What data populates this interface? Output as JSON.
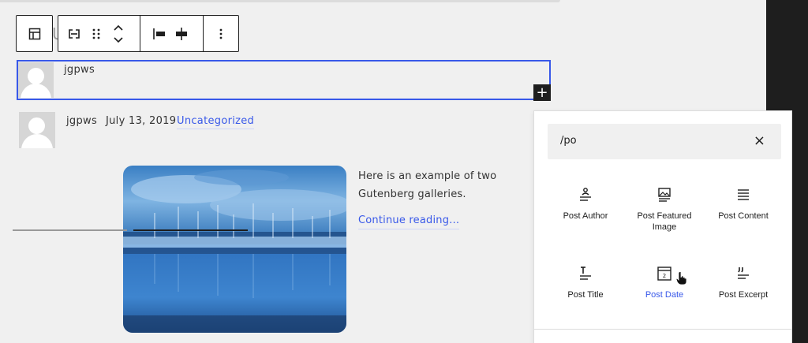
{
  "toolbar": {
    "parent_icon": "layout-icon",
    "items": [
      "transform-icon",
      "drag-handle-icon",
      "move-up-down-icon",
      "align-left-icon",
      "align-center-icon",
      "more-options-icon"
    ]
  },
  "selected_block": {
    "author_name": "jgpws",
    "inserter_label": "+"
  },
  "post_meta": {
    "author": "jgpws",
    "date": "July 13, 2019",
    "category": "Uncategorized"
  },
  "post": {
    "excerpt": "Here is an example of two Gutenberg galleries.",
    "read_more": "Continue reading…"
  },
  "inserter": {
    "search_value": "/po",
    "clear_label": "×",
    "blocks": [
      {
        "label": "Post Author",
        "icon": "post-author-icon"
      },
      {
        "label": "Post Featured Image",
        "icon": "post-featured-image-icon"
      },
      {
        "label": "Post Content",
        "icon": "post-content-icon"
      },
      {
        "label": "Post Title",
        "icon": "post-title-icon"
      },
      {
        "label": "Post Date",
        "icon": "post-date-icon"
      },
      {
        "label": "Post Excerpt",
        "icon": "post-excerpt-icon"
      }
    ]
  },
  "colors": {
    "accent": "#3858e9",
    "dark": "#1e1e1e",
    "canvas": "#f0f0f0"
  }
}
